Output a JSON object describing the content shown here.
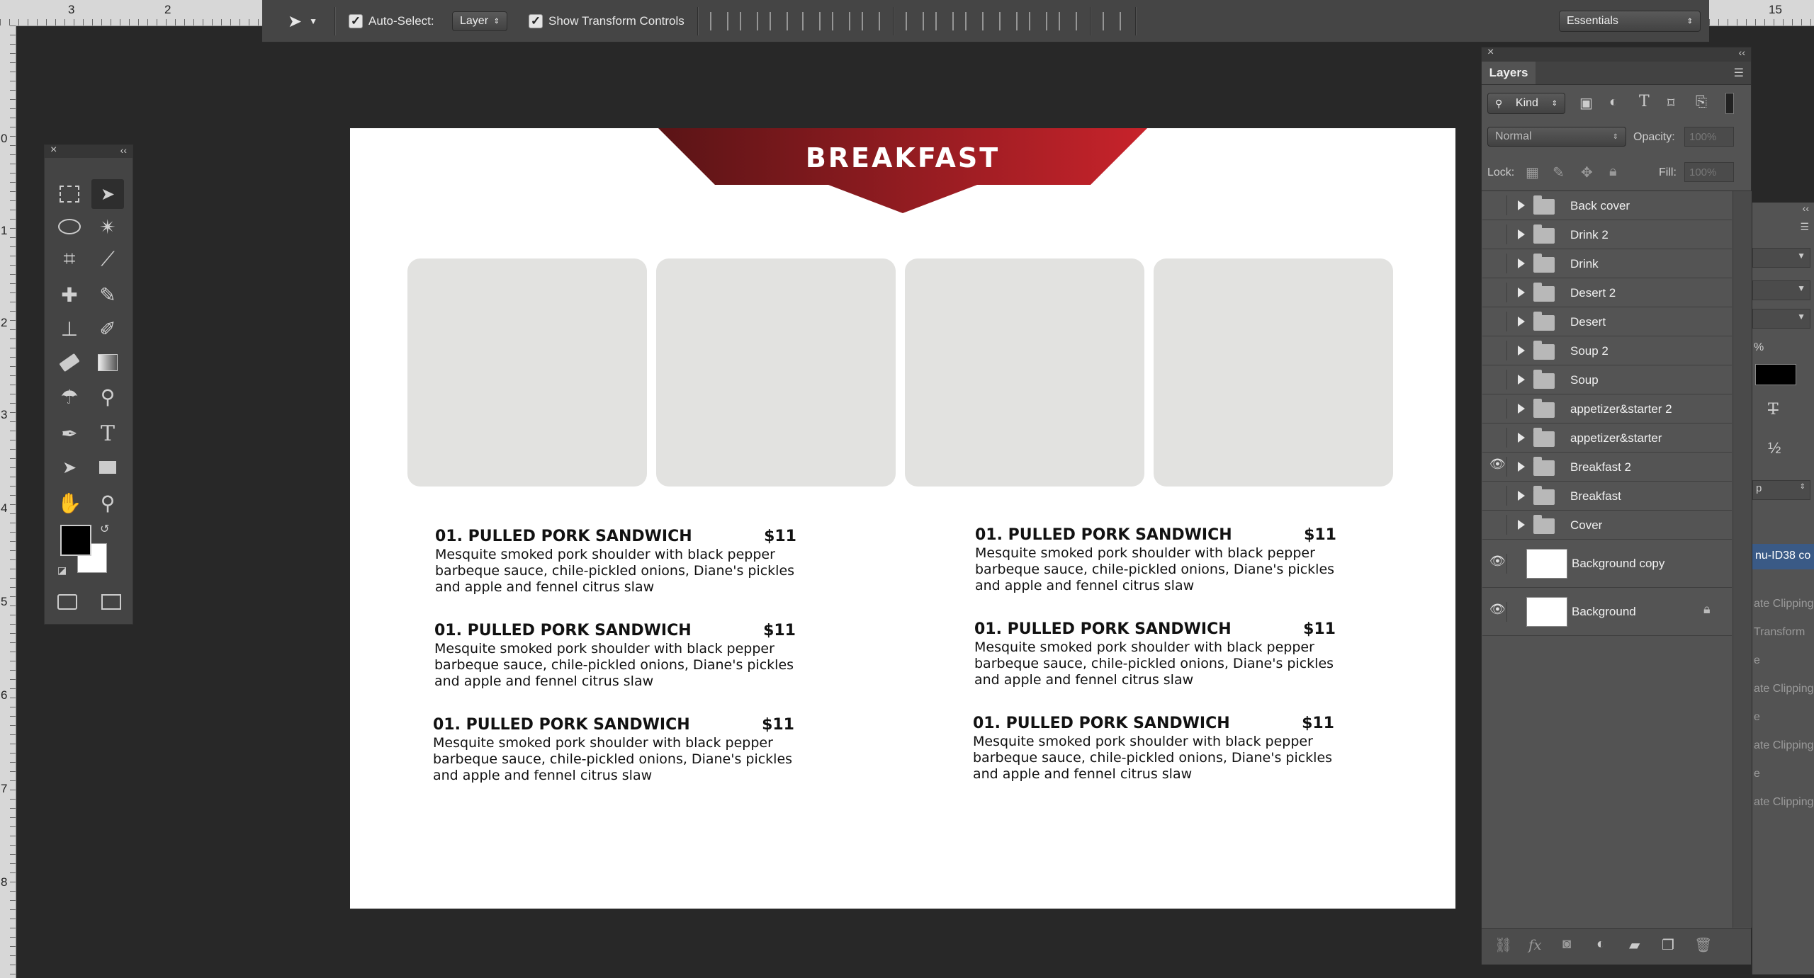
{
  "rulers": {
    "top_left_numbers": [
      "3",
      "2"
    ],
    "top_right_numbers": [
      "15"
    ],
    "left_numbers": [
      "0",
      "1",
      "2",
      "3",
      "4",
      "5",
      "6",
      "7",
      "8"
    ]
  },
  "options_bar": {
    "auto_select_label": "Auto-Select:",
    "auto_select_checked": "✓",
    "auto_select_value": "Layer",
    "transform_checked": "✓",
    "transform_label": "Show Transform Controls",
    "workspace_value": "Essentials"
  },
  "document": {
    "banner_title": "BREAKFAST",
    "banner_colors": {
      "dark": "#5a1416",
      "bright": "#c8232b"
    },
    "menu_items": [
      {
        "name": "01. PULLED PORK SANDWICH",
        "price": "$11",
        "desc": "Mesquite smoked pork shoulder with black pepper barbeque sauce, chile-pickled onions, Diane's pickles and apple and fennel citrus slaw"
      },
      {
        "name": "01. PULLED PORK SANDWICH",
        "price": "$11",
        "desc": "Mesquite smoked pork shoulder with black pepper barbeque sauce, chile-pickled onions, Diane's pickles and apple and fennel citrus slaw"
      },
      {
        "name": "01. PULLED PORK SANDWICH",
        "price": "$11",
        "desc": "Mesquite smoked pork shoulder with black pepper barbeque sauce, chile-pickled onions, Diane's pickles and apple and fennel citrus slaw"
      },
      {
        "name": "01. PULLED PORK SANDWICH",
        "price": "$11",
        "desc": "Mesquite smoked pork shoulder with black pepper barbeque sauce, chile-pickled onions, Diane's pickles and apple and fennel citrus slaw"
      },
      {
        "name": "01. PULLED PORK SANDWICH",
        "price": "$11",
        "desc": "Mesquite smoked pork shoulder with black pepper barbeque sauce, chile-pickled onions, Diane's pickles and apple and fennel citrus slaw"
      },
      {
        "name": "01. PULLED PORK SANDWICH",
        "price": "$11",
        "desc": "Mesquite smoked pork shoulder with black pepper barbeque sauce, chile-pickled onions, Diane's pickles and apple and fennel citrus slaw"
      }
    ]
  },
  "toolbox": {
    "tools": [
      "marquee-icon",
      "move-icon",
      "lasso-icon",
      "magic-wand-icon",
      "crop-icon",
      "eyedropper-icon",
      "healing-icon",
      "brush-icon",
      "stamp-icon",
      "history-brush-icon",
      "eraser-icon",
      "gradient-icon",
      "blur-icon",
      "dodge-icon",
      "pen-icon",
      "type-icon",
      "path-select-icon",
      "rectangle-icon",
      "hand-icon",
      "zoom-icon"
    ],
    "type_glyph": "T"
  },
  "layers_panel": {
    "tab_label": "Layers",
    "filter_label": "Kind",
    "blend_mode": "Normal",
    "opacity_label": "Opacity:",
    "opacity_value": "100%",
    "lock_label": "Lock:",
    "fill_label": "Fill:",
    "fill_value": "100%",
    "groups": [
      {
        "name": "Back cover",
        "visible": false
      },
      {
        "name": "Drink 2",
        "visible": false
      },
      {
        "name": "Drink",
        "visible": false
      },
      {
        "name": "Desert 2",
        "visible": false
      },
      {
        "name": "Desert",
        "visible": false
      },
      {
        "name": "Soup 2",
        "visible": false
      },
      {
        "name": "Soup",
        "visible": false
      },
      {
        "name": "appetizer&starter 2",
        "visible": false
      },
      {
        "name": "appetizer&starter",
        "visible": false
      },
      {
        "name": "Breakfast 2",
        "visible": true
      },
      {
        "name": "Breakfast",
        "visible": false
      },
      {
        "name": "Cover",
        "visible": false
      }
    ],
    "layers": [
      {
        "name": "Background copy",
        "visible": true,
        "locked": false
      },
      {
        "name": "Background",
        "visible": true,
        "locked": true
      }
    ],
    "footer_icons": [
      "link-icon",
      "fx-icon",
      "mask-icon",
      "adjustment-icon",
      "group-icon",
      "new-layer-icon",
      "trash-icon"
    ],
    "fx_glyph": "fx"
  },
  "side_panel": {
    "field_fragment": "%",
    "glyph_t": "T",
    "glyph_half": "½",
    "dropdown_fragment": "p",
    "layer_name_fragment": "nu-ID38 co",
    "items": [
      "ate Clipping",
      "Transform",
      "e",
      "ate Clipping",
      "e",
      "ate Clipping",
      "e",
      "ate Clipping"
    ]
  }
}
